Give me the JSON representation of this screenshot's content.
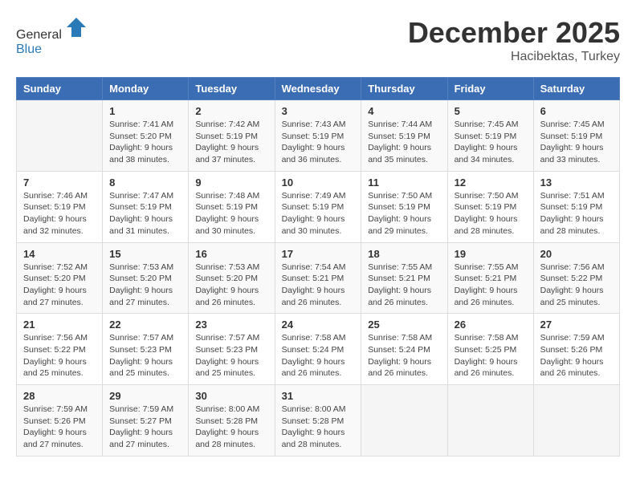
{
  "header": {
    "logo_line1": "General",
    "logo_line2": "Blue",
    "month": "December 2025",
    "location": "Hacibektas, Turkey"
  },
  "weekdays": [
    "Sunday",
    "Monday",
    "Tuesday",
    "Wednesday",
    "Thursday",
    "Friday",
    "Saturday"
  ],
  "weeks": [
    [
      null,
      {
        "day": 1,
        "sunrise": "7:41 AM",
        "sunset": "5:20 PM",
        "daylight": "9 hours and 38 minutes."
      },
      {
        "day": 2,
        "sunrise": "7:42 AM",
        "sunset": "5:19 PM",
        "daylight": "9 hours and 37 minutes."
      },
      {
        "day": 3,
        "sunrise": "7:43 AM",
        "sunset": "5:19 PM",
        "daylight": "9 hours and 36 minutes."
      },
      {
        "day": 4,
        "sunrise": "7:44 AM",
        "sunset": "5:19 PM",
        "daylight": "9 hours and 35 minutes."
      },
      {
        "day": 5,
        "sunrise": "7:45 AM",
        "sunset": "5:19 PM",
        "daylight": "9 hours and 34 minutes."
      },
      {
        "day": 6,
        "sunrise": "7:45 AM",
        "sunset": "5:19 PM",
        "daylight": "9 hours and 33 minutes."
      }
    ],
    [
      {
        "day": 7,
        "sunrise": "7:46 AM",
        "sunset": "5:19 PM",
        "daylight": "9 hours and 32 minutes."
      },
      {
        "day": 8,
        "sunrise": "7:47 AM",
        "sunset": "5:19 PM",
        "daylight": "9 hours and 31 minutes."
      },
      {
        "day": 9,
        "sunrise": "7:48 AM",
        "sunset": "5:19 PM",
        "daylight": "9 hours and 30 minutes."
      },
      {
        "day": 10,
        "sunrise": "7:49 AM",
        "sunset": "5:19 PM",
        "daylight": "9 hours and 30 minutes."
      },
      {
        "day": 11,
        "sunrise": "7:50 AM",
        "sunset": "5:19 PM",
        "daylight": "9 hours and 29 minutes."
      },
      {
        "day": 12,
        "sunrise": "7:50 AM",
        "sunset": "5:19 PM",
        "daylight": "9 hours and 28 minutes."
      },
      {
        "day": 13,
        "sunrise": "7:51 AM",
        "sunset": "5:19 PM",
        "daylight": "9 hours and 28 minutes."
      }
    ],
    [
      {
        "day": 14,
        "sunrise": "7:52 AM",
        "sunset": "5:20 PM",
        "daylight": "9 hours and 27 minutes."
      },
      {
        "day": 15,
        "sunrise": "7:53 AM",
        "sunset": "5:20 PM",
        "daylight": "9 hours and 27 minutes."
      },
      {
        "day": 16,
        "sunrise": "7:53 AM",
        "sunset": "5:20 PM",
        "daylight": "9 hours and 26 minutes."
      },
      {
        "day": 17,
        "sunrise": "7:54 AM",
        "sunset": "5:21 PM",
        "daylight": "9 hours and 26 minutes."
      },
      {
        "day": 18,
        "sunrise": "7:55 AM",
        "sunset": "5:21 PM",
        "daylight": "9 hours and 26 minutes."
      },
      {
        "day": 19,
        "sunrise": "7:55 AM",
        "sunset": "5:21 PM",
        "daylight": "9 hours and 26 minutes."
      },
      {
        "day": 20,
        "sunrise": "7:56 AM",
        "sunset": "5:22 PM",
        "daylight": "9 hours and 25 minutes."
      }
    ],
    [
      {
        "day": 21,
        "sunrise": "7:56 AM",
        "sunset": "5:22 PM",
        "daylight": "9 hours and 25 minutes."
      },
      {
        "day": 22,
        "sunrise": "7:57 AM",
        "sunset": "5:23 PM",
        "daylight": "9 hours and 25 minutes."
      },
      {
        "day": 23,
        "sunrise": "7:57 AM",
        "sunset": "5:23 PM",
        "daylight": "9 hours and 25 minutes."
      },
      {
        "day": 24,
        "sunrise": "7:58 AM",
        "sunset": "5:24 PM",
        "daylight": "9 hours and 26 minutes."
      },
      {
        "day": 25,
        "sunrise": "7:58 AM",
        "sunset": "5:24 PM",
        "daylight": "9 hours and 26 minutes."
      },
      {
        "day": 26,
        "sunrise": "7:58 AM",
        "sunset": "5:25 PM",
        "daylight": "9 hours and 26 minutes."
      },
      {
        "day": 27,
        "sunrise": "7:59 AM",
        "sunset": "5:26 PM",
        "daylight": "9 hours and 26 minutes."
      }
    ],
    [
      {
        "day": 28,
        "sunrise": "7:59 AM",
        "sunset": "5:26 PM",
        "daylight": "9 hours and 27 minutes."
      },
      {
        "day": 29,
        "sunrise": "7:59 AM",
        "sunset": "5:27 PM",
        "daylight": "9 hours and 27 minutes."
      },
      {
        "day": 30,
        "sunrise": "8:00 AM",
        "sunset": "5:28 PM",
        "daylight": "9 hours and 28 minutes."
      },
      {
        "day": 31,
        "sunrise": "8:00 AM",
        "sunset": "5:28 PM",
        "daylight": "9 hours and 28 minutes."
      },
      null,
      null,
      null
    ]
  ]
}
